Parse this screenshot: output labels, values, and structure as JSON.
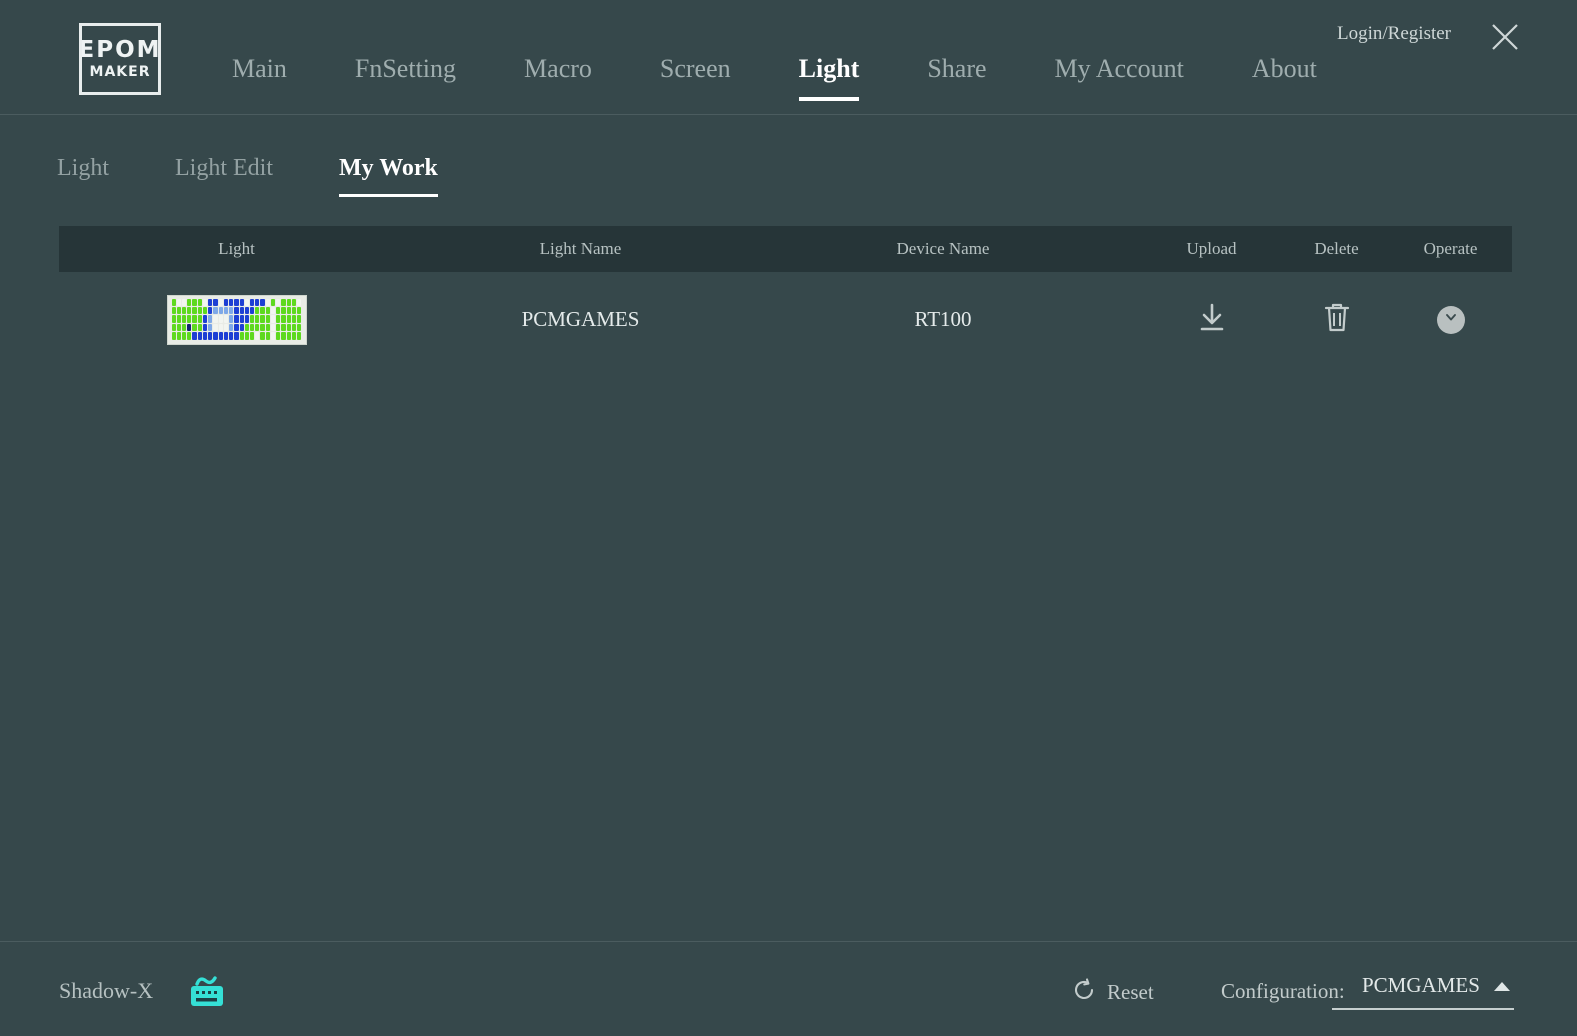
{
  "app": {
    "logo_top": "EPOM",
    "logo_bottom": "MAKER",
    "background_color": "#36484b",
    "accent_color": "#35e0d6"
  },
  "header": {
    "nav": [
      {
        "label": "Main",
        "active": false
      },
      {
        "label": "FnSetting",
        "active": false
      },
      {
        "label": "Macro",
        "active": false
      },
      {
        "label": "Screen",
        "active": false
      },
      {
        "label": "Light",
        "active": true
      },
      {
        "label": "Share",
        "active": false
      },
      {
        "label": "My Account",
        "active": false
      },
      {
        "label": "About",
        "active": false
      }
    ],
    "login_register": "Login/Register",
    "close_icon": "close-icon"
  },
  "subtabs": [
    {
      "label": "Light",
      "active": false
    },
    {
      "label": "Light Edit",
      "active": false
    },
    {
      "label": "My Work",
      "active": true
    }
  ],
  "table": {
    "columns": [
      "Light",
      "Light Name",
      "Device Name",
      "Upload",
      "Delete",
      "Operate"
    ],
    "rows": [
      {
        "thumbnail": "keyboard-light-preview",
        "light_name": "PCMGAMES",
        "device_name": "RT100",
        "upload_icon": "download-icon",
        "delete_icon": "trash-icon",
        "operate_icon": "chevron-down-icon"
      }
    ],
    "header_bg": "#263538"
  },
  "thumbnail_colors": {
    "green": "#5ed91e",
    "blue": "#1d3fd4",
    "light_blue": "#7fa9e8",
    "white": "#f2f5f0",
    "dark_blue": "#15256e",
    "frame": "#e9ece6"
  },
  "footer": {
    "device_label": "Shadow-X",
    "device_icon": "keyboard-icon",
    "reset_label": "Reset",
    "reset_icon": "refresh-icon",
    "configuration_label": "Configuration:",
    "configuration_value": "PCMGAMES",
    "configuration_arrow": "chevron-up-icon"
  }
}
